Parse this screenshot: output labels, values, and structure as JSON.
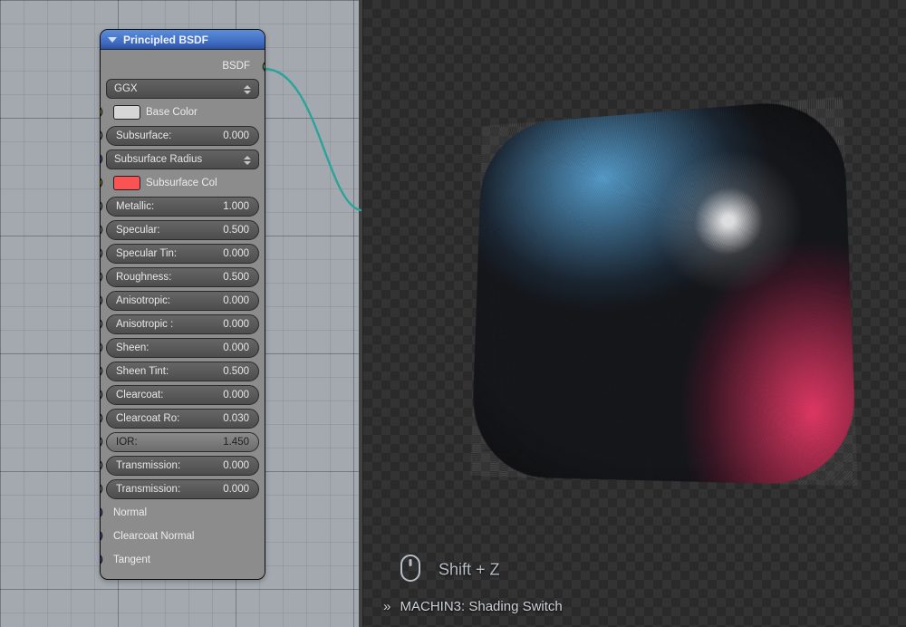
{
  "node": {
    "title": "Principled BSDF",
    "output_label": "BSDF",
    "distribution": "GGX",
    "base_color_label": "Base Color",
    "subsurf_radius_label": "Subsurface Radius",
    "subsurf_color_label": "Subsurface Col",
    "normal_label": "Normal",
    "clearcoat_normal_label": "Clearcoat Normal",
    "tangent_label": "Tangent",
    "params": {
      "subsurface": {
        "label": "Subsurface:",
        "value": "0.000"
      },
      "metallic": {
        "label": "Metallic:",
        "value": "1.000"
      },
      "specular": {
        "label": "Specular:",
        "value": "0.500"
      },
      "specular_tint": {
        "label": "Specular Tin:",
        "value": "0.000"
      },
      "roughness": {
        "label": "Roughness:",
        "value": "0.500"
      },
      "anisotropic": {
        "label": "Anisotropic:",
        "value": "0.000"
      },
      "anisotropic_rot": {
        "label": "Anisotropic :",
        "value": "0.000"
      },
      "sheen": {
        "label": "Sheen:",
        "value": "0.000"
      },
      "sheen_tint": {
        "label": "Sheen Tint:",
        "value": "0.500"
      },
      "clearcoat": {
        "label": "Clearcoat:",
        "value": "0.000"
      },
      "clearcoat_rough": {
        "label": "Clearcoat Ro:",
        "value": "0.030"
      },
      "ior": {
        "label": "IOR:",
        "value": "1.450"
      },
      "transmission": {
        "label": "Transmission:",
        "value": "0.000"
      },
      "transmission_r": {
        "label": "Transmission:",
        "value": "0.000"
      }
    }
  },
  "viewport": {
    "hint_shortcut": "Shift + Z",
    "status_text": "MACHIN3: Shading Switch"
  }
}
